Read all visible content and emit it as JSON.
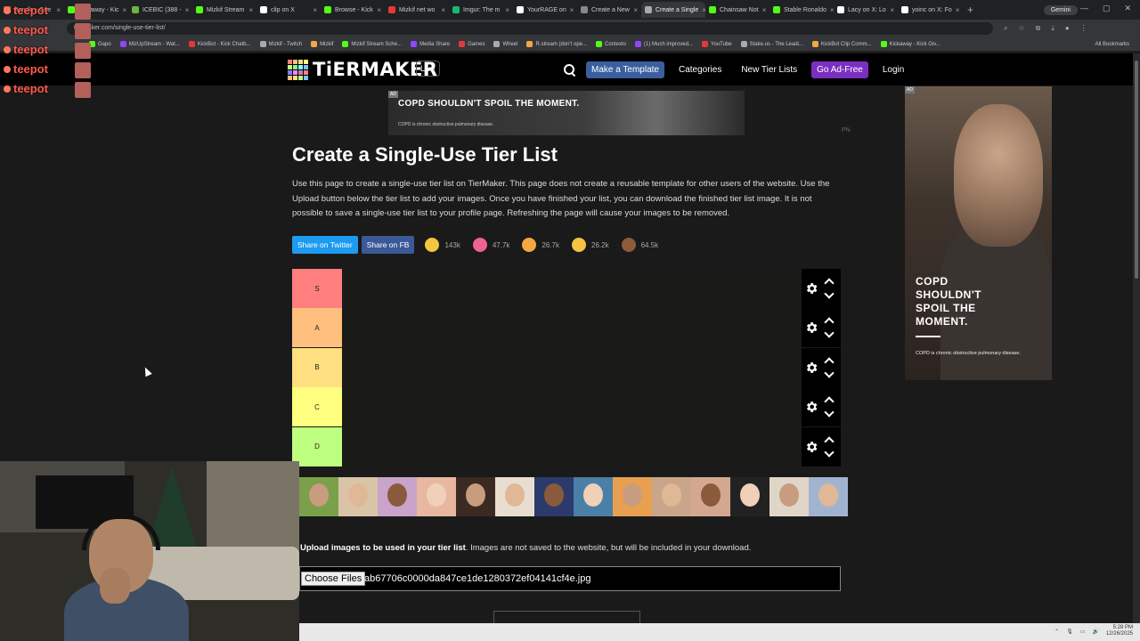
{
  "browser": {
    "tabs": [
      {
        "label": "Bandle - Gue",
        "color": "#e85d4a"
      },
      {
        "label": "Kickaway - Kic",
        "color": "#53fc18"
      },
      {
        "label": "ICEBIC (388 -",
        "color": "#6cb33f"
      },
      {
        "label": "Mizkif Stream",
        "color": "#53fc18"
      },
      {
        "label": "clip on X",
        "color": "#fff"
      },
      {
        "label": "Browse - Kick",
        "color": "#53fc18"
      },
      {
        "label": "Mizkif net wo",
        "color": "#e53935"
      },
      {
        "label": "Imgur: The m",
        "color": "#1bb76e"
      },
      {
        "label": "YourRAGE on",
        "color": "#fff"
      },
      {
        "label": "Create a New",
        "color": "#888"
      },
      {
        "label": "Create a Single",
        "color": "#aaa"
      },
      {
        "label": "Chainsaw Not",
        "color": "#53fc18"
      },
      {
        "label": "Stable Ronaldo",
        "color": "#53fc18"
      },
      {
        "label": "Lacy on X: Lo",
        "color": "#fff"
      },
      {
        "label": "yoinc on X: Fo",
        "color": "#fff"
      }
    ],
    "active_tab_index": 10,
    "gemini_label": "Gemini",
    "url": "tiermaker.com/single-use-tier-list/",
    "bookmarks": [
      "Gapo",
      "MizUpStream - Wat...",
      "KickBot - Kick Chatb...",
      "Mizkif - Twitch",
      "Mizkif",
      "Mizkif Stream Sche...",
      "Media Share",
      "Games",
      "Wheel",
      "R.stream (don't ope...",
      "Contexto",
      "(1) Much improved...",
      "YouTube",
      "Stake.us - The Leadi...",
      "KickBot Clip Comm...",
      "Kickaway - Kick Giv..."
    ],
    "all_bookmarks": "All Bookmarks"
  },
  "site": {
    "logo": "TiERMAKER",
    "live": "Live",
    "nav": {
      "make_template": "Make a Template",
      "categories": "Categories",
      "new_tier_lists": "New Tier Lists",
      "go_ad_free": "Go Ad-Free",
      "login": "Login"
    }
  },
  "ads": {
    "badge": "AD",
    "top_headline": "COPD SHOULDN'T SPOIL THE MOMENT.",
    "top_sub": "COPD is chronic obstructive pulmonary disease.",
    "side_headline": "COPD SHOULDN'T SPOIL THE MOMENT.",
    "side_sub": "COPD is chronic obstructive pulmonary disease.",
    "pn": "PN"
  },
  "main": {
    "title": "Create a Single-Use Tier List",
    "intro": "Use this page to create a single-use tier list on TierMaker. This page does not create a reusable template for other users of the website. Use the Upload button below the tier list to add your images. Once you have finished your list, you can download the finished tier list image. It is not possible to save a single-use tier list to your profile page. Refreshing the page will cause your images to be removed.",
    "share_twitter": "Share on Twitter",
    "share_fb": "Share on FB",
    "reactions": [
      {
        "icon": "laughing-face-icon",
        "count": "143k",
        "color": "#f5c542"
      },
      {
        "icon": "heart-eyes-icon",
        "count": "47.7k",
        "color": "#f06292"
      },
      {
        "icon": "grinning-face-icon",
        "count": "26.7k",
        "color": "#f5a742"
      },
      {
        "icon": "raised-hands-icon",
        "count": "26.2k",
        "color": "#f5c542"
      },
      {
        "icon": "poop-icon",
        "count": "64.5k",
        "color": "#8d5a3b"
      }
    ],
    "tiers": [
      {
        "label": "S",
        "color": "#ff7f7f"
      },
      {
        "label": "A",
        "color": "#ffbf7f"
      },
      {
        "label": "B",
        "color": "#ffdf7f"
      },
      {
        "label": "C",
        "color": "#ffff7f"
      },
      {
        "label": "D",
        "color": "#bfff7f"
      }
    ],
    "thumbnail_colors": [
      "#7aa04a",
      "#d9c4a8",
      "#c9a3c9",
      "#e8b7a0",
      "#3a2a22",
      "#e9ddd0",
      "#2b3a6b",
      "#4a7fa8",
      "#e8a050",
      "#c9a68a",
      "#d4a890",
      "#222222",
      "#e0d6c8",
      "#a0b4d0"
    ],
    "upload_bold": "Upload images to be used in your tier list",
    "upload_rest": ". Images are not saved to the website, but will be included in your download.",
    "choose_files": "Choose Files",
    "file_name": "ab67706c0000da847ce1de1280372ef04141cf4e.jpg"
  },
  "overlay": {
    "chat_name": "teepot"
  },
  "taskbar": {
    "time": "5:28 PM",
    "date": "12/26/2025"
  }
}
